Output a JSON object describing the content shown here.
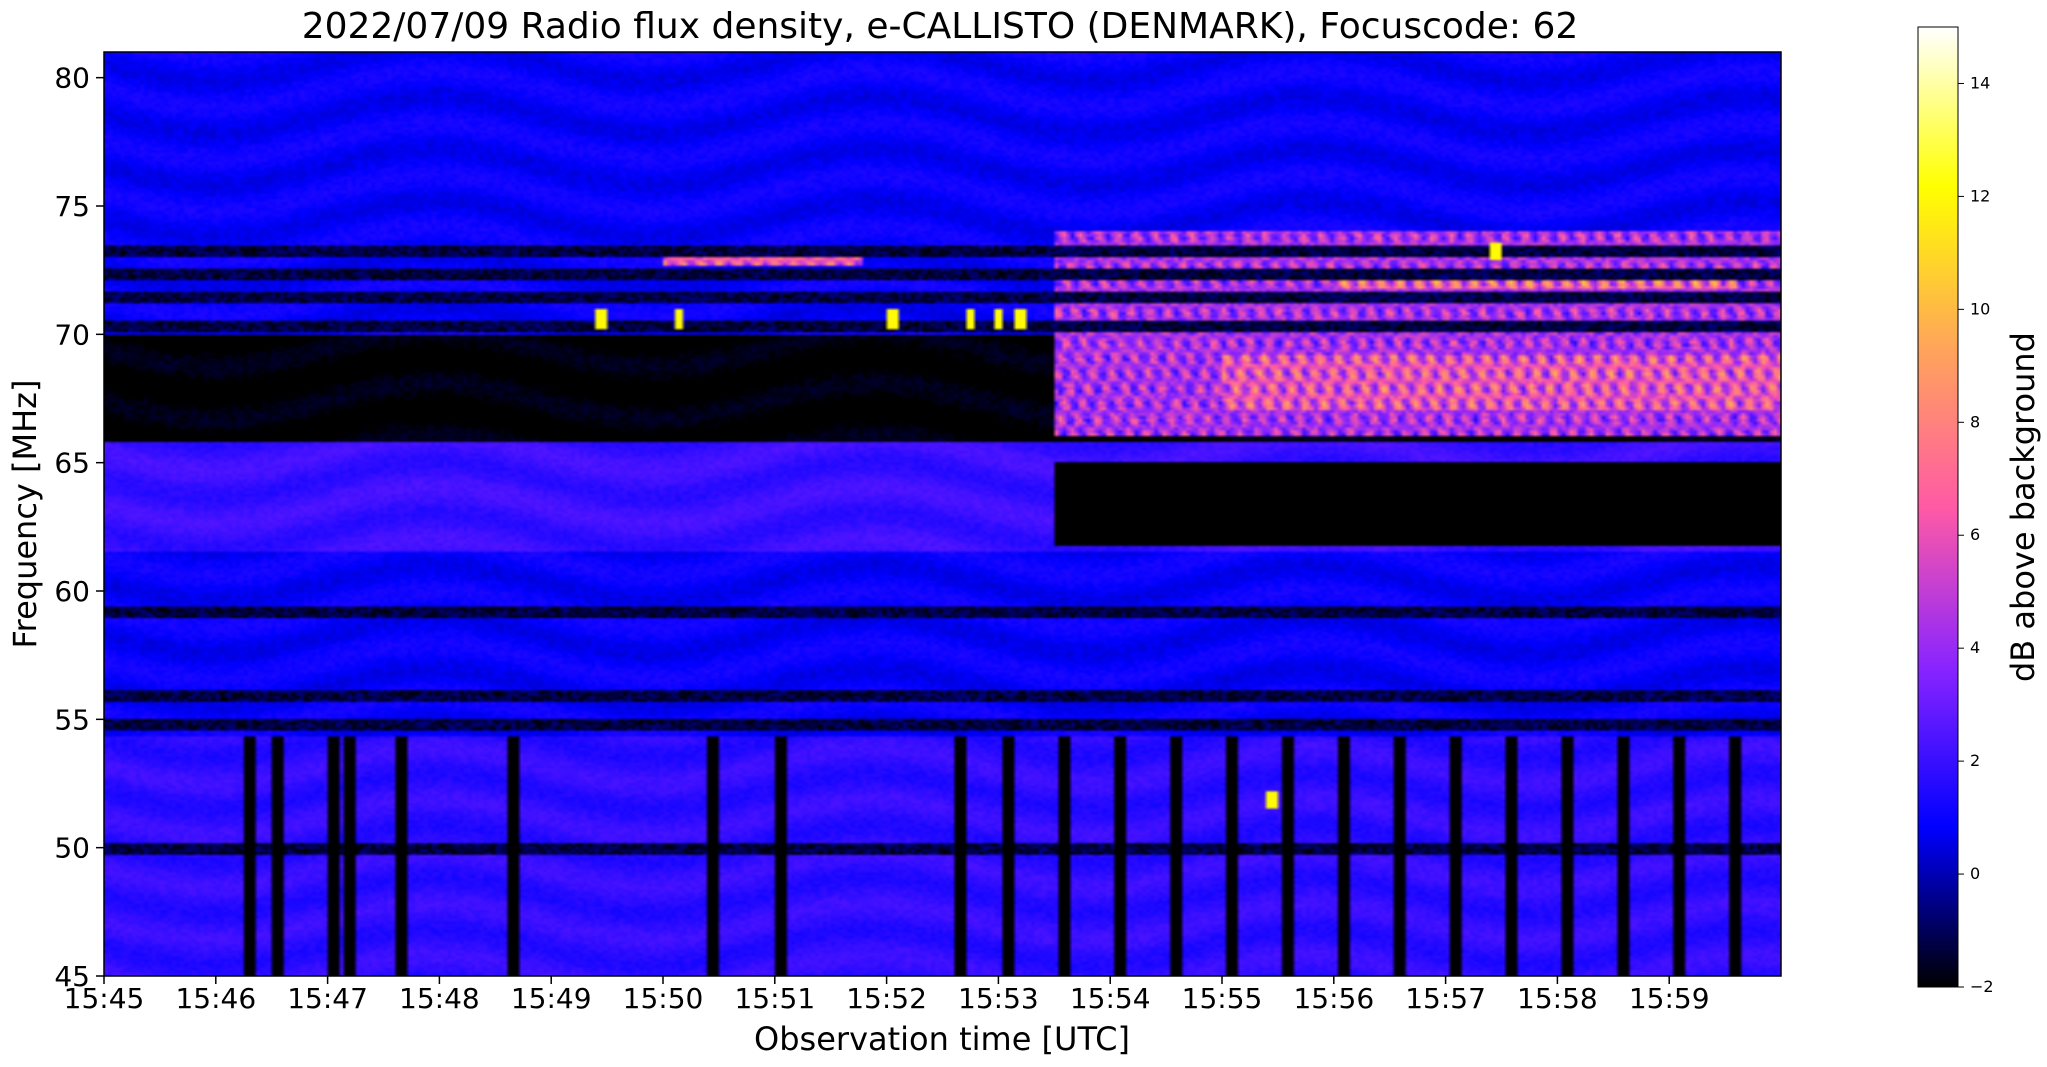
{
  "chart_data": {
    "type": "heatmap",
    "title": "2022/07/09  Radio flux density, e-CALLISTO (DENMARK), Focuscode: 62",
    "xlabel": "Observation time [UTC]",
    "ylabel": "Frequency [MHz]",
    "x_ticks": [
      "15:45",
      "15:46",
      "15:47",
      "15:48",
      "15:49",
      "15:50",
      "15:51",
      "15:52",
      "15:53",
      "15:54",
      "15:55",
      "15:56",
      "15:57",
      "15:58",
      "15:59"
    ],
    "x_range_minutes_after_1545": [
      0,
      15
    ],
    "y_ticks": [
      45,
      50,
      55,
      60,
      65,
      70,
      75,
      80
    ],
    "ylim": [
      45,
      81
    ],
    "colorbar": {
      "label": "dB above background",
      "range": [
        -2,
        15
      ],
      "ticks": [
        -2,
        0,
        2,
        4,
        6,
        8,
        10,
        12,
        14
      ],
      "colormap": "gnuplot2",
      "colors": [
        "#000000",
        "#0000ff",
        "#8a24ff",
        "#ff5aa5",
        "#ffa559",
        "#ffff00",
        "#ffffff"
      ]
    },
    "features": {
      "background_bands": [
        {
          "f_min": 45.0,
          "f_max": 54.3,
          "level": 1.8
        },
        {
          "f_min": 54.3,
          "f_max": 61.5,
          "level": 0.9
        },
        {
          "f_min": 61.5,
          "f_max": 65.8,
          "level": 2.0
        },
        {
          "f_min": 65.8,
          "f_max": 70.0,
          "level": -2.0
        },
        {
          "f_min": 70.0,
          "f_max": 81.0,
          "level": 0.9
        }
      ],
      "dark_horizontal_lines_mhz": [
        49.9,
        54.8,
        55.9,
        59.2,
        70.3,
        71.4,
        72.3,
        73.2
      ],
      "dark_vertical_stripes_min": [
        1.3,
        1.55,
        2.05,
        2.2,
        2.65,
        3.65,
        5.45,
        6.05,
        7.65,
        8.1,
        8.6,
        9.1,
        9.6,
        10.1,
        10.6,
        11.1,
        11.6,
        12.1,
        12.6,
        13.1,
        13.6,
        14.1,
        14.6
      ],
      "burst_patches": [
        {
          "t0": 8.5,
          "t1": 15.0,
          "f0": 66.0,
          "f1": 74.0,
          "level": 6.5
        },
        {
          "t0": 10.0,
          "t1": 15.0,
          "f0": 67.0,
          "f1": 69.2,
          "level": 9.0
        },
        {
          "t0": 11.0,
          "t1": 14.6,
          "f0": 71.8,
          "f1": 72.6,
          "level": 10.0
        },
        {
          "t0": 5.0,
          "t1": 6.8,
          "f0": 72.7,
          "f1": 73.2,
          "level": 9.5
        },
        {
          "t0": 8.5,
          "t1": 15.0,
          "f0": 61.8,
          "f1": 65.0,
          "level": -2.0
        }
      ],
      "bright_spots": [
        {
          "t": 4.45,
          "f": 70.6
        },
        {
          "t": 5.15,
          "f": 70.6
        },
        {
          "t": 7.05,
          "f": 70.6
        },
        {
          "t": 7.75,
          "f": 70.6
        },
        {
          "t": 8.0,
          "f": 70.6
        },
        {
          "t": 8.2,
          "f": 70.6
        },
        {
          "t": 10.45,
          "f": 51.9
        },
        {
          "t": 12.45,
          "f": 73.2
        }
      ]
    }
  }
}
